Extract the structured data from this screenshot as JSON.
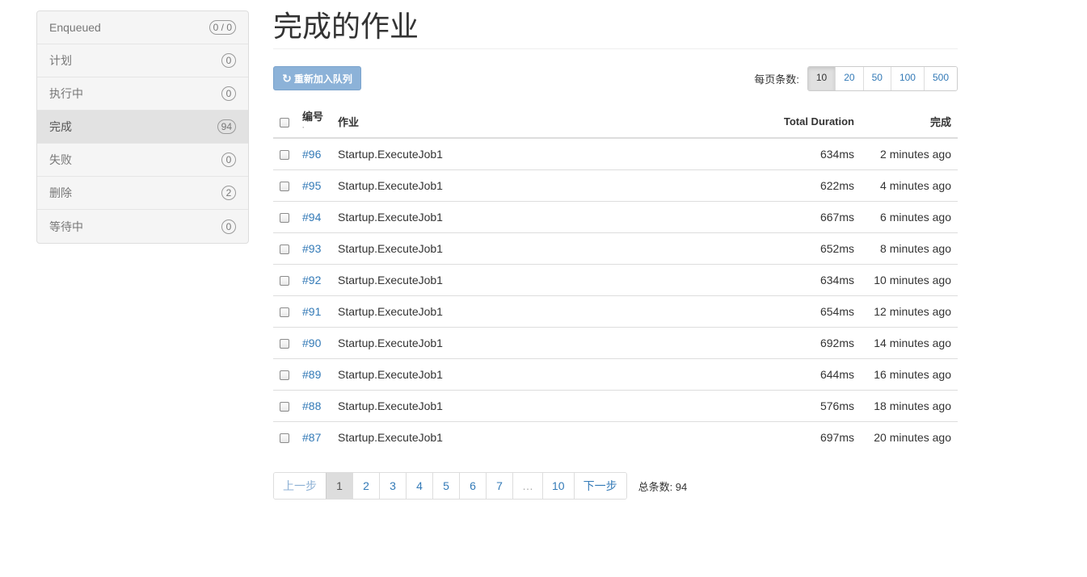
{
  "sidebar": {
    "items": [
      {
        "label": "Enqueued",
        "count": "0 / 0"
      },
      {
        "label": "计划",
        "count": "0"
      },
      {
        "label": "执行中",
        "count": "0"
      },
      {
        "label": "完成",
        "count": "94"
      },
      {
        "label": "失败",
        "count": "0"
      },
      {
        "label": "删除",
        "count": "2"
      },
      {
        "label": "等待中",
        "count": "0"
      }
    ],
    "active_index": 3
  },
  "header": {
    "title": "完成的作业"
  },
  "toolbar": {
    "requeue_label": "重新加入队列",
    "requeue_icon": "refresh-icon",
    "per_page_label": "每页条数:",
    "per_page_options": [
      "10",
      "20",
      "50",
      "100",
      "500"
    ],
    "per_page_selected": "10"
  },
  "table": {
    "headers": {
      "id": "编号",
      "job": "作业",
      "duration": "Total Duration",
      "completed": "完成"
    },
    "rows": [
      {
        "id": "#96",
        "job": "Startup.ExecuteJob1",
        "duration": "634ms",
        "completed": "2 minutes ago"
      },
      {
        "id": "#95",
        "job": "Startup.ExecuteJob1",
        "duration": "622ms",
        "completed": "4 minutes ago"
      },
      {
        "id": "#94",
        "job": "Startup.ExecuteJob1",
        "duration": "667ms",
        "completed": "6 minutes ago"
      },
      {
        "id": "#93",
        "job": "Startup.ExecuteJob1",
        "duration": "652ms",
        "completed": "8 minutes ago"
      },
      {
        "id": "#92",
        "job": "Startup.ExecuteJob1",
        "duration": "634ms",
        "completed": "10 minutes ago"
      },
      {
        "id": "#91",
        "job": "Startup.ExecuteJob1",
        "duration": "654ms",
        "completed": "12 minutes ago"
      },
      {
        "id": "#90",
        "job": "Startup.ExecuteJob1",
        "duration": "692ms",
        "completed": "14 minutes ago"
      },
      {
        "id": "#89",
        "job": "Startup.ExecuteJob1",
        "duration": "644ms",
        "completed": "16 minutes ago"
      },
      {
        "id": "#88",
        "job": "Startup.ExecuteJob1",
        "duration": "576ms",
        "completed": "18 minutes ago"
      },
      {
        "id": "#87",
        "job": "Startup.ExecuteJob1",
        "duration": "697ms",
        "completed": "20 minutes ago"
      }
    ]
  },
  "pagination": {
    "prev_label": "上一步",
    "pages": [
      "1",
      "2",
      "3",
      "4",
      "5",
      "6",
      "7"
    ],
    "ellipsis": "…",
    "last_page": "10",
    "next_label": "下一步",
    "current": "1",
    "total_label": "总条数: 94"
  },
  "colors": {
    "link": "#337ab7",
    "requeue_button_bg": "#8cb2d8",
    "sidebar_bg": "#f5f5f5",
    "sidebar_active_bg": "#e2e2e2"
  }
}
